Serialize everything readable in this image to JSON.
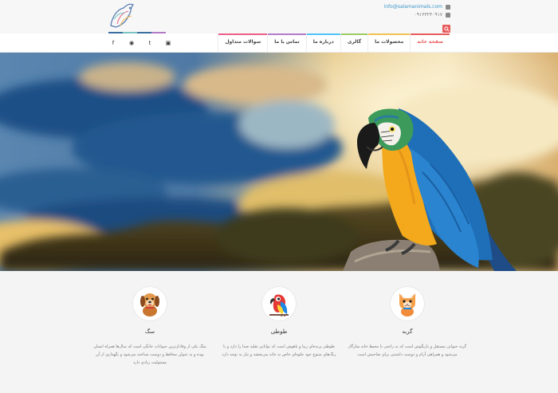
{
  "header": {
    "email": "info@salamanimals.com",
    "phone": "۰۹۱۳۳۲۴۰۹۱۷"
  },
  "colors": {
    "accent": "#e85b5b",
    "stripes": [
      "#3b6fa0",
      "#7bc6c2",
      "#b07cc6",
      "#ec5f8a",
      "#f2c14e",
      "#9ccc65",
      "#4fc3f7"
    ]
  },
  "nav": {
    "items": [
      {
        "label": "صفحه خانه",
        "active": true,
        "color": "#e85b5b"
      },
      {
        "label": "محصولات ما",
        "active": false,
        "color": "#f2c14e"
      },
      {
        "label": "گالری",
        "active": false,
        "color": "#9ccc65"
      },
      {
        "label": "درباره ما",
        "active": false,
        "color": "#4fc3f7"
      },
      {
        "label": "تماس با ما",
        "active": false,
        "color": "#b07cc6"
      },
      {
        "label": "سوالات متداول",
        "active": false,
        "color": "#ec5f8a"
      }
    ]
  },
  "social": [
    {
      "icon": "facebook-icon",
      "glyph": "f"
    },
    {
      "icon": "android-icon",
      "glyph": "◉"
    },
    {
      "icon": "twitter-icon",
      "glyph": "t"
    },
    {
      "icon": "instagram-icon",
      "glyph": "▣"
    }
  ],
  "features": [
    {
      "title": "سگ",
      "icon": "dog-icon",
      "text": "سگ یکی از وفادارترین حیوانات خانگی است که سال‌ها همراه انسان بوده و به عنوان محافظ و دوست شناخته می‌شود و نگهداری از آن مسئولیت زیادی دارد"
    },
    {
      "title": "طوطی",
      "icon": "parrot-icon",
      "text": "طوطی پرنده‌ای زیبا و باهوش است که توانایی تقلید صدا را دارد و با رنگ‌های متنوع خود جلوه‌ای خاص به خانه می‌بخشد و نیاز به توجه دارد"
    },
    {
      "title": "گربه",
      "icon": "cat-icon",
      "text": "گربه حیوانی مستقل و بازیگوش است که به راحتی با محیط خانه سازگار می‌شود و همراهی آرام و دوست داشتنی برای صاحبش است"
    }
  ]
}
